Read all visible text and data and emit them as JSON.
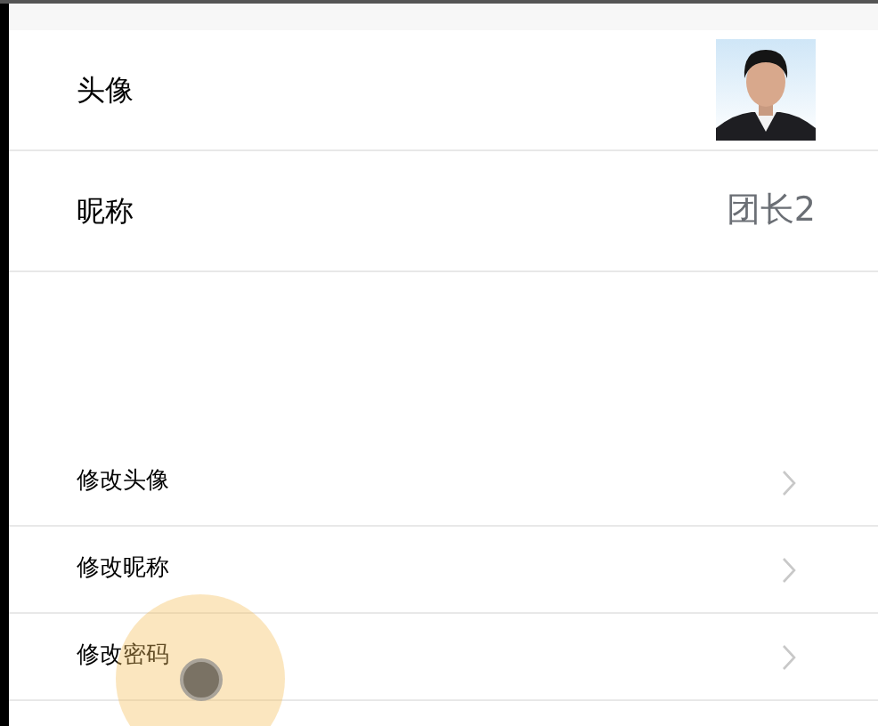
{
  "profile": [
    {
      "kind": "picture",
      "label": "头像"
    },
    {
      "kind": "text",
      "label": "昵称",
      "value": "团长2"
    }
  ],
  "menu": [
    {
      "label": "修改头像"
    },
    {
      "label": "修改昵称"
    },
    {
      "label": "修改密码"
    }
  ]
}
